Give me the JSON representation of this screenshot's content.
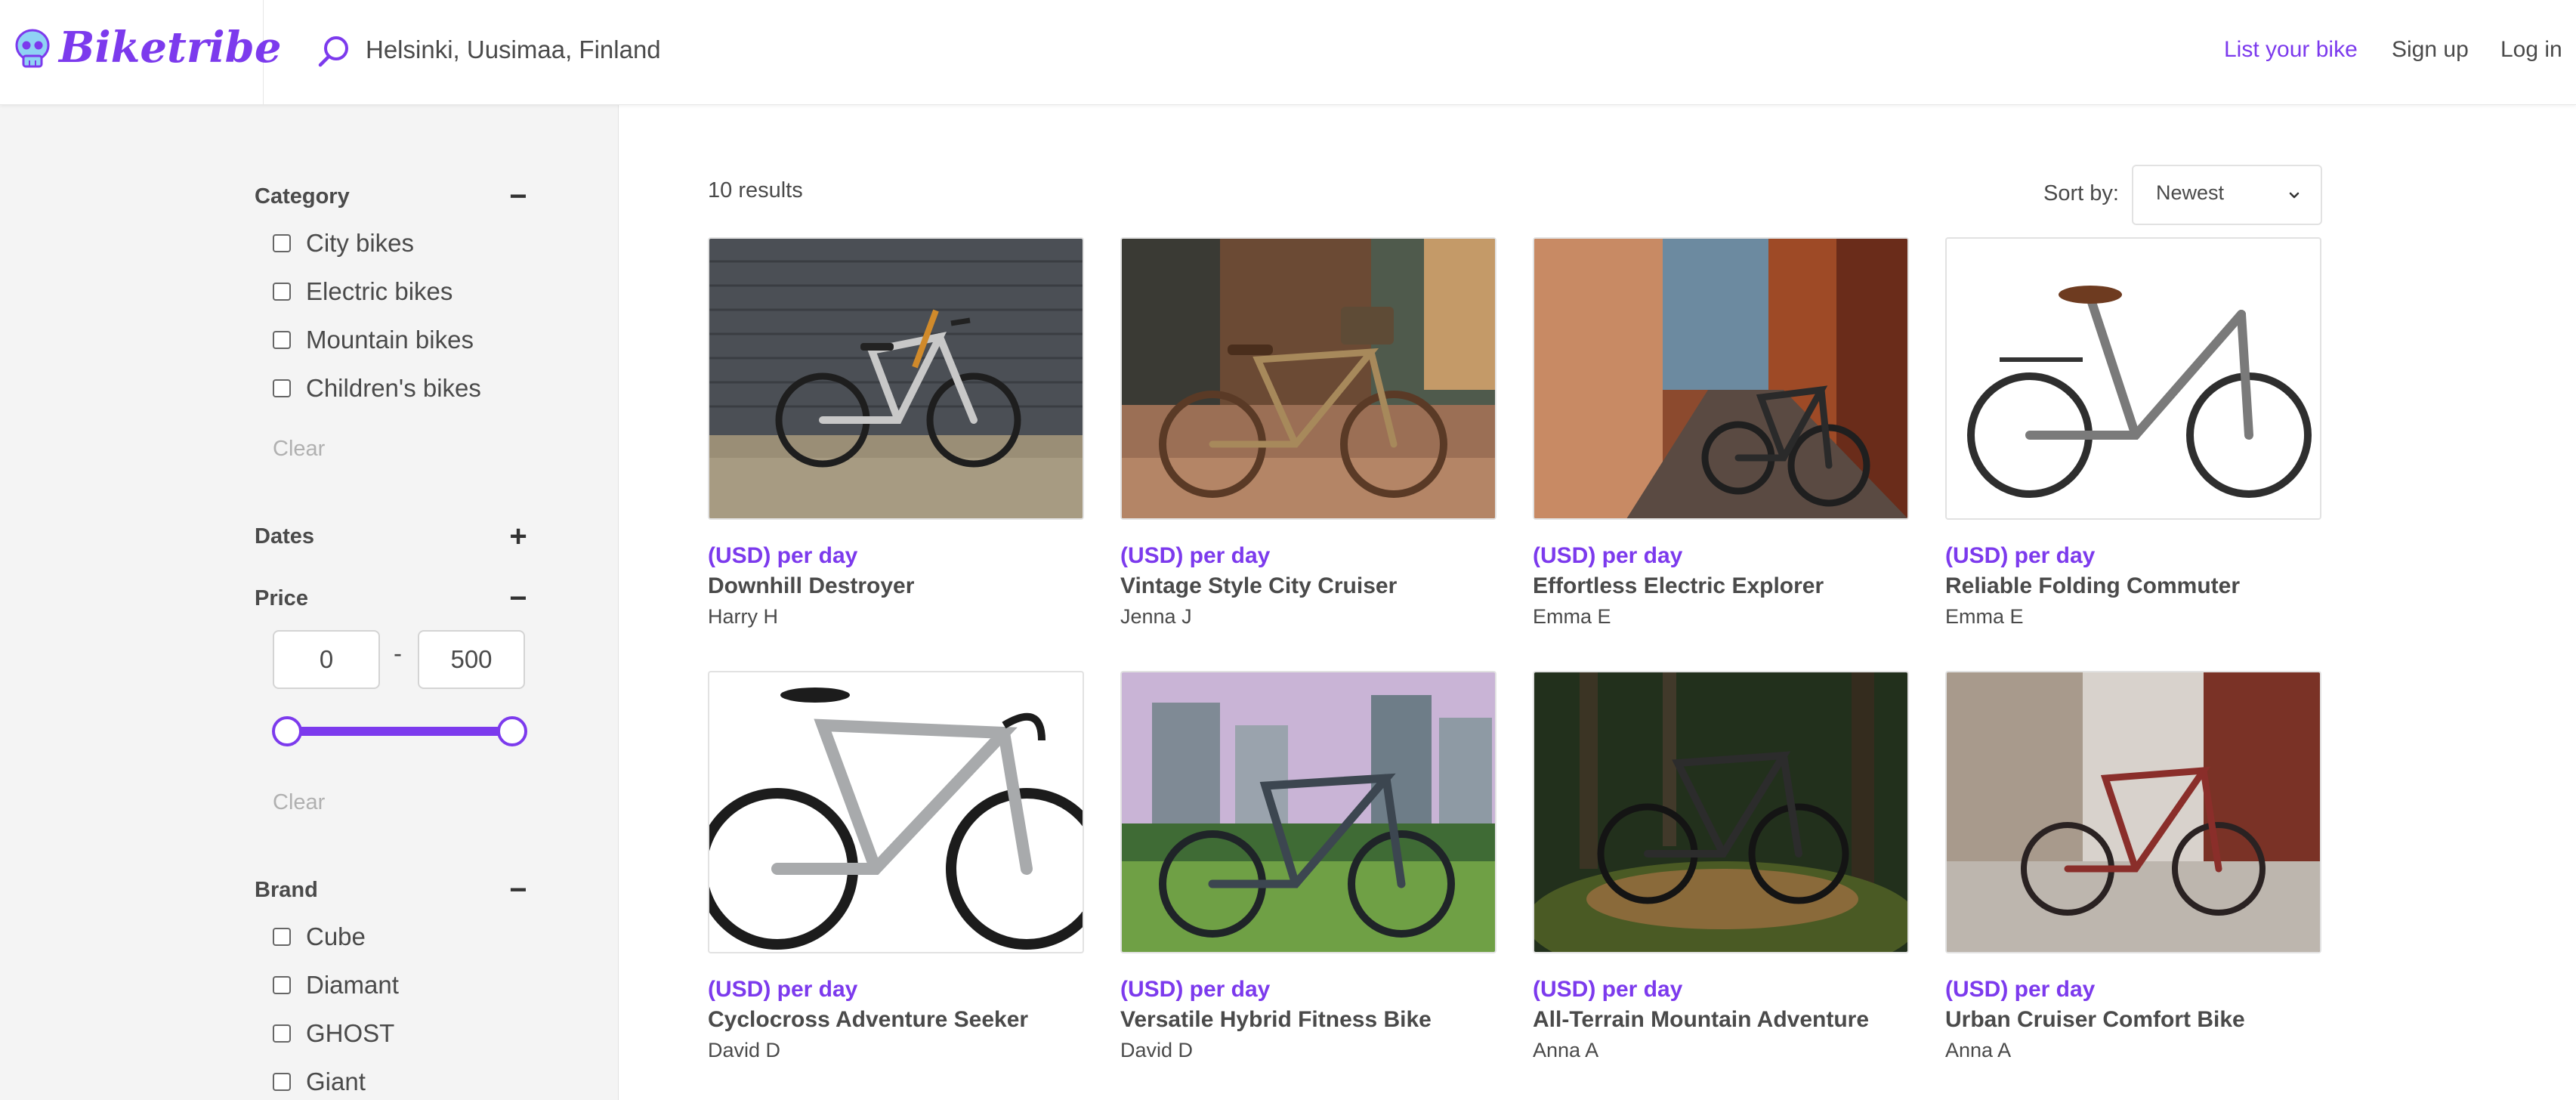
{
  "brand": {
    "name": "Biketribe",
    "logo_icon": "skull-icon",
    "accent": "#7c3aed"
  },
  "search": {
    "value": "Helsinki, Uusimaa, Finland",
    "icon": "search-icon"
  },
  "nav": {
    "list_bike": "List your bike",
    "sign_up": "Sign up",
    "log_in": "Log in"
  },
  "filters": {
    "category": {
      "title": "Category",
      "toggle": "−",
      "options": [
        "City bikes",
        "Electric bikes",
        "Mountain bikes",
        "Children's bikes"
      ],
      "clear": "Clear"
    },
    "dates": {
      "title": "Dates",
      "toggle": "+"
    },
    "price": {
      "title": "Price",
      "toggle": "−",
      "min": "0",
      "max": "500",
      "separator": "-",
      "range_fraction": [
        0,
        1
      ],
      "clear": "Clear"
    },
    "brand": {
      "title": "Brand",
      "toggle": "−",
      "options": [
        "Cube",
        "Diamant",
        "GHOST",
        "Giant"
      ]
    }
  },
  "results": {
    "count_label": "10 results"
  },
  "sort": {
    "label": "Sort by:",
    "value": "Newest"
  },
  "listings": [
    {
      "price": "(USD) per day",
      "title": "Downhill Destroyer",
      "author": "Harry H",
      "image": "mountain bike against dark wooden wall"
    },
    {
      "price": "(USD) per day",
      "title": "Vintage Style City Cruiser",
      "author": "Jenna J",
      "image": "vintage city bike on cobblestone street"
    },
    {
      "price": "(USD) per day",
      "title": "Effortless Electric Explorer",
      "author": "Emma E",
      "image": "electric bike in narrow alley"
    },
    {
      "price": "(USD) per day",
      "title": "Reliable Folding Commuter",
      "author": "Emma E",
      "image": "folding bike on white background"
    },
    {
      "price": "(USD) per day",
      "title": "Cyclocross Adventure Seeker",
      "author": "David D",
      "image": "silver cyclocross bike on white background"
    },
    {
      "price": "(USD) per day",
      "title": "Versatile Hybrid Fitness Bike",
      "author": "David D",
      "image": "hybrid bike on grass with city skyline"
    },
    {
      "price": "(USD) per day",
      "title": "All-Terrain Mountain Adventure",
      "author": "Anna A",
      "image": "mountain bike in forest"
    },
    {
      "price": "(USD) per day",
      "title": "Urban Cruiser Comfort Bike",
      "author": "Anna A",
      "image": "red city bike on sunny street"
    }
  ]
}
